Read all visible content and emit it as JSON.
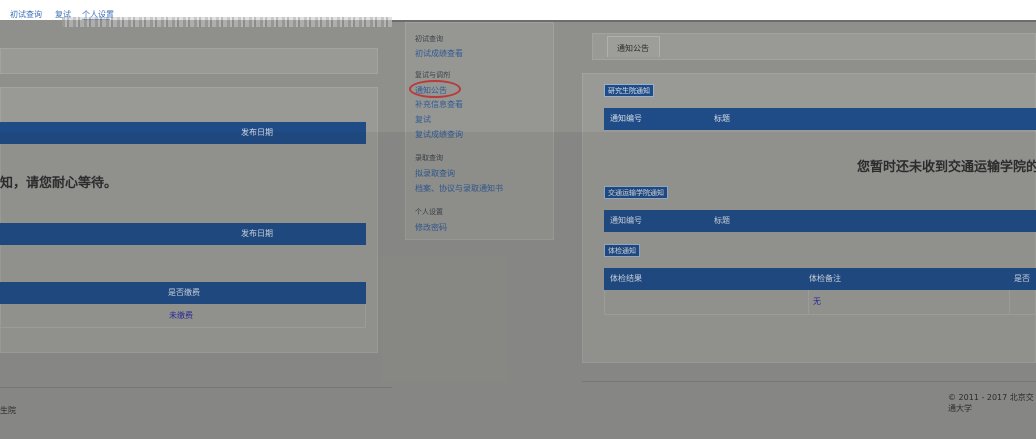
{
  "topnav": {
    "items": [
      {
        "label": "初试查询"
      },
      {
        "label": "复试"
      },
      {
        "label": "个人设置"
      }
    ]
  },
  "menu": {
    "sections": [
      {
        "title": "初试查询",
        "items": [
          "初试成绩查看"
        ]
      },
      {
        "title": "复试与调剂",
        "items": [
          "通知公告",
          "补充信息查看",
          "复试",
          "复试成绩查询"
        ]
      },
      {
        "title": "录取查询",
        "items": [
          "拟录取查询",
          "档案、协议与录取通知书"
        ]
      },
      {
        "title": "个人设置",
        "items": [
          "修改密码"
        ]
      }
    ],
    "active_item": "通知公告"
  },
  "left_panel": {
    "table1": {
      "col_date": "发布日期"
    },
    "message": "知，请您耐心等待。",
    "table2": {
      "col_date": "发布日期"
    },
    "table3": {
      "col_paid": "是否缴费"
    },
    "row": {
      "paid_value": "未缴费"
    },
    "footer_left": "生院"
  },
  "right_panel": {
    "tab_label": "通知公告",
    "section1": {
      "tag": "研究生院通知",
      "col_no": "通知编号",
      "col_title": "标题"
    },
    "message": "您暂时还未收到交通运输学院的复试",
    "section2": {
      "tag": "交通运输学院通知",
      "col_no": "通知编号",
      "col_title": "标题"
    },
    "section3": {
      "tag": "体检通知",
      "col_result": "体检结果",
      "col_note": "体检备注",
      "col_extra": "是否"
    },
    "row": {
      "note_value": "无"
    },
    "copyright": "© 2011 - 2017 北京交通大学"
  },
  "colors": {
    "table_header": "#1f4c86",
    "link": "#2f5b94",
    "highlight_circle": "#b83a3a"
  }
}
